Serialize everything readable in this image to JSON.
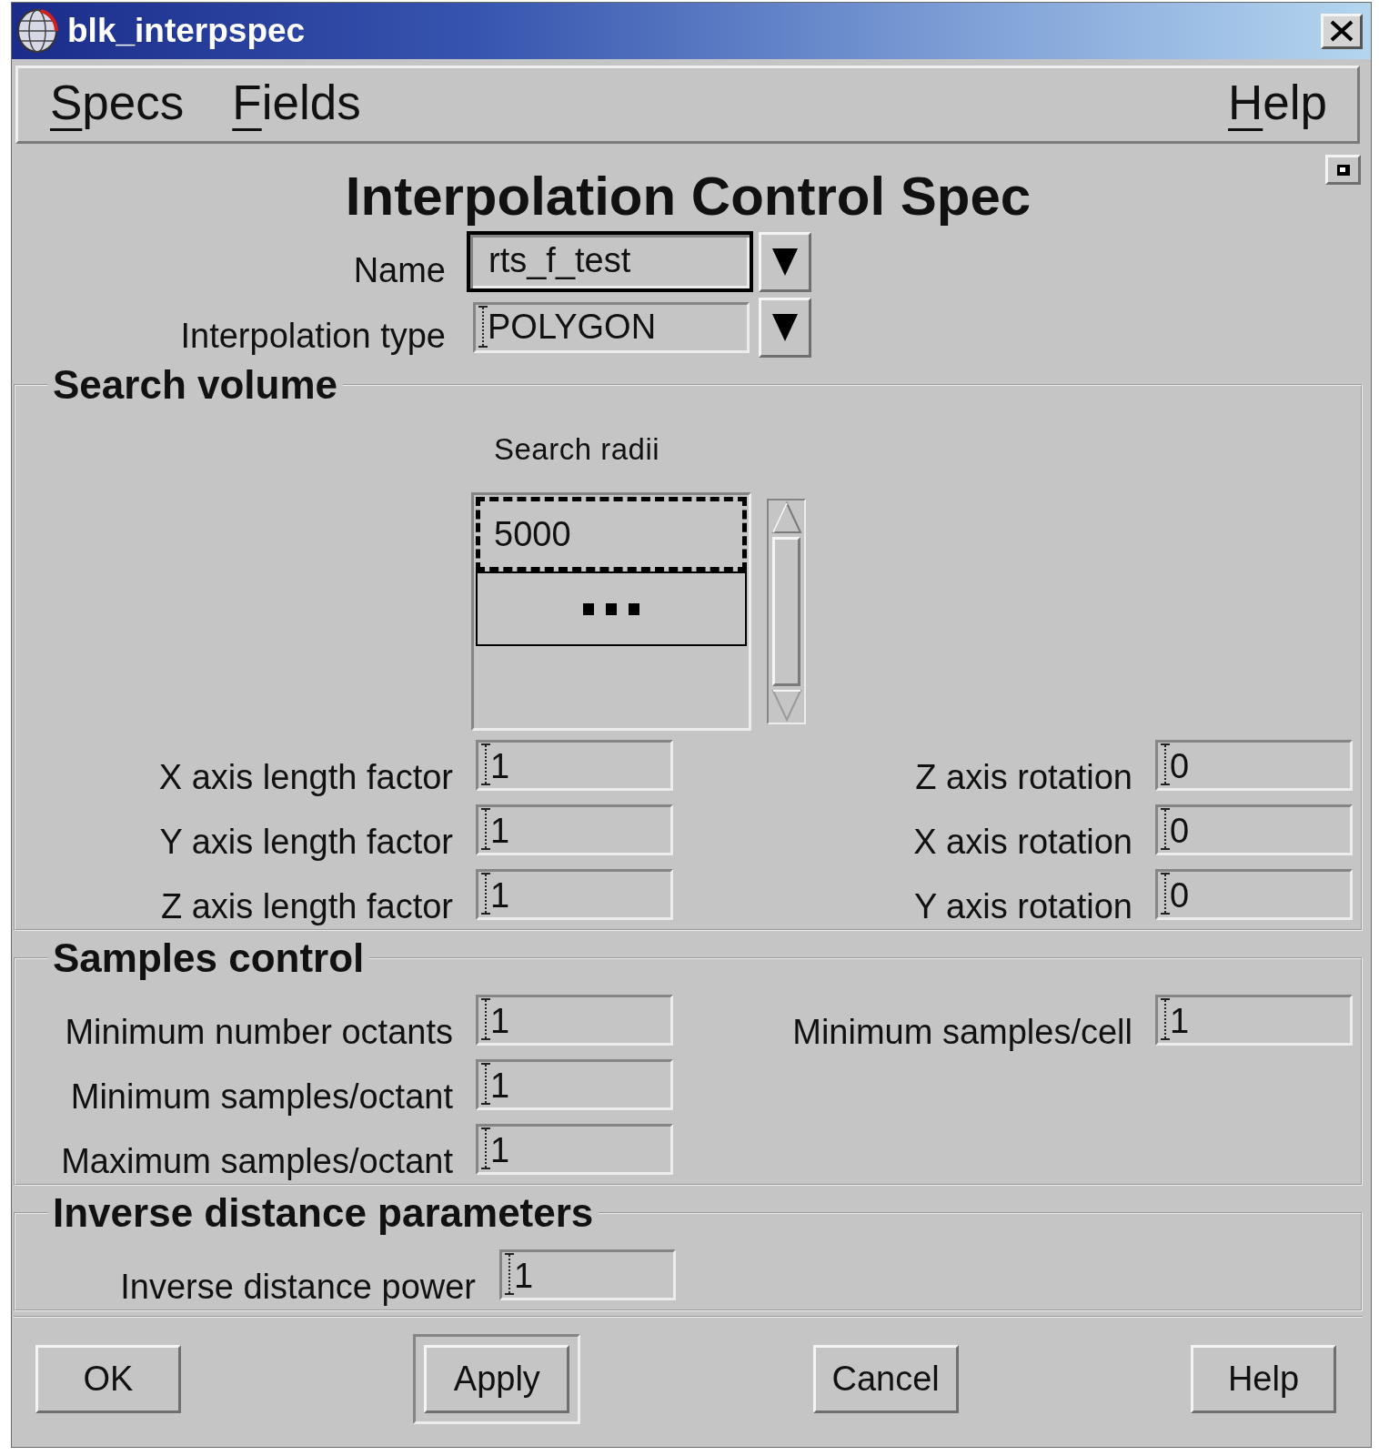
{
  "window": {
    "title": "blk_interpspec"
  },
  "menu_bar": {
    "left": [
      {
        "label": "Specs"
      },
      {
        "label": "Fields"
      }
    ],
    "right": [
      {
        "label": "Help"
      }
    ]
  },
  "heading": "Interpolation Control Spec",
  "spec_fields": [
    {
      "label": "Name",
      "value": "rts_f_test",
      "focused": true
    },
    {
      "label": "Interpolation type",
      "value": "POLYGON",
      "focused": false
    }
  ],
  "search_volume": {
    "title": "Search volume",
    "radii_label": "Search radii",
    "radii": [
      {
        "kind": "value",
        "value": "5000",
        "selected": true
      },
      {
        "kind": "more",
        "selected": false
      }
    ],
    "left_fields": [
      {
        "label": "X axis length factor",
        "value": "1",
        "focused": false
      },
      {
        "label": "Y axis length factor",
        "value": "1",
        "focused": false
      },
      {
        "label": "Z axis length factor",
        "value": "1",
        "focused": false
      }
    ],
    "right_fields": [
      {
        "label": "Z axis rotation",
        "value": "0",
        "focused": false
      },
      {
        "label": "X axis rotation",
        "value": "0",
        "focused": false
      },
      {
        "label": "Y axis rotation",
        "value": "0",
        "focused": false
      }
    ]
  },
  "samples_control": {
    "title": "Samples control",
    "left_fields": [
      {
        "label": "Minimum number octants",
        "value": "1",
        "focused": false
      },
      {
        "label": "Minimum samples/octant",
        "value": "1",
        "focused": false
      },
      {
        "label": "Maximum samples/octant",
        "value": "1",
        "focused": false
      }
    ],
    "right_fields": [
      {
        "label": "Minimum samples/cell",
        "value": "1",
        "focused": false
      }
    ]
  },
  "inverse_distance": {
    "title": "Inverse distance parameters",
    "fields": [
      {
        "label": "Inverse distance power",
        "value": "1",
        "focused": false
      }
    ]
  },
  "buttons": [
    {
      "label": "OK",
      "default": false
    },
    {
      "label": "Apply",
      "default": true
    },
    {
      "label": "Cancel",
      "default": false
    },
    {
      "label": "Help",
      "default": false
    }
  ]
}
